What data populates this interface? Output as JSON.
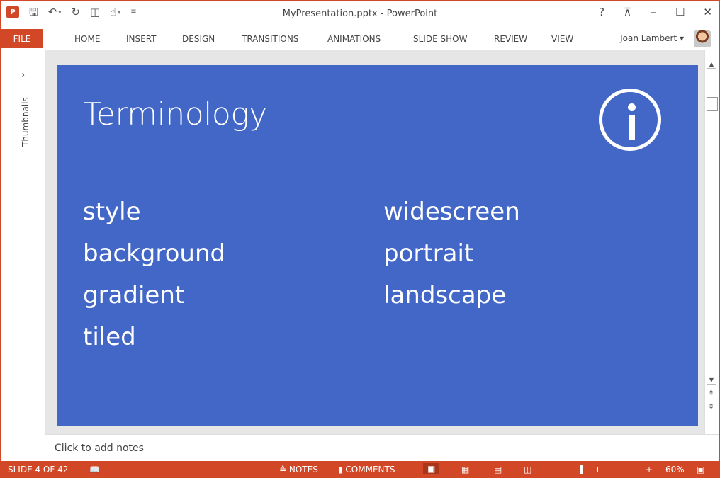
{
  "window": {
    "title": "MyPresentation.pptx - PowerPoint"
  },
  "qat": {
    "logo": "P",
    "save_icon": "save-icon",
    "undo_icon": "undo-icon",
    "redo_icon": "redo-icon",
    "present_icon": "present-icon",
    "touch_icon": "touch-mode-icon",
    "customize": "customize-qat-icon"
  },
  "window_controls": {
    "help": "?",
    "ribbon_display": "⊼",
    "minimize": "–",
    "maximize": "☐",
    "close": "✕"
  },
  "ribbon": {
    "file": "FILE",
    "tabs": [
      "HOME",
      "INSERT",
      "DESIGN",
      "TRANSITIONS",
      "ANIMATIONS",
      "SLIDE SHOW",
      "REVIEW",
      "VIEW"
    ],
    "user": "Joan Lambert"
  },
  "thumbnails": {
    "chevron": "›",
    "label": "Thumbnails"
  },
  "slide": {
    "title": "Terminology",
    "left_terms": [
      "style",
      "background",
      "gradient",
      "tiled"
    ],
    "right_terms": [
      "widescreen",
      "portrait",
      "landscape"
    ]
  },
  "notes": {
    "placeholder": "Click to add notes"
  },
  "status": {
    "slide_indicator": "SLIDE 4 OF 42",
    "notes_label": "NOTES",
    "comments_label": "COMMENTS",
    "zoom_minus": "–",
    "zoom_plus": "+",
    "zoom": "60%",
    "zoom_level": 0.6
  },
  "colors": {
    "accent": "#d24726",
    "slide_bg": "#4267c6"
  }
}
